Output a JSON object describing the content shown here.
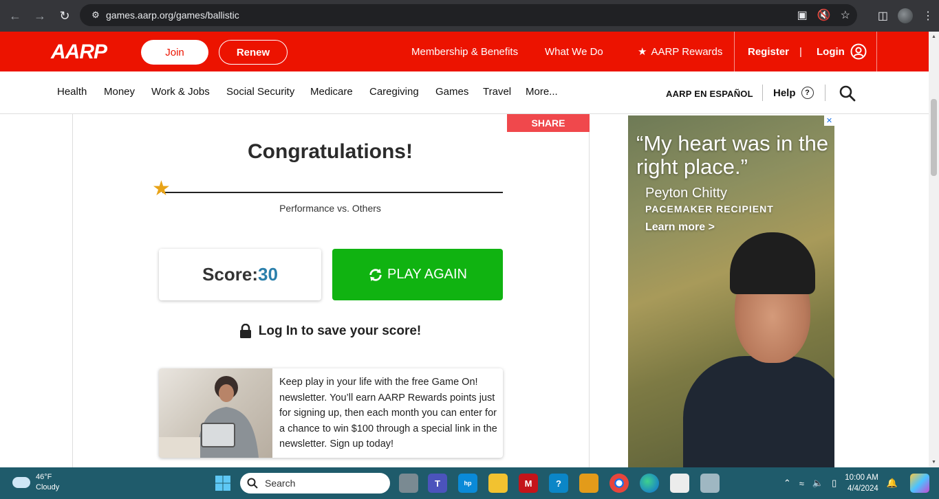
{
  "browser": {
    "url": "games.aarp.org/games/ballistic"
  },
  "header": {
    "logo": "AARP",
    "join": "Join",
    "renew": "Renew",
    "membership": "Membership & Benefits",
    "what_we_do": "What We Do",
    "rewards": "AARP Rewards",
    "register": "Register",
    "separator": "|",
    "login": "Login"
  },
  "subnav": {
    "items": [
      "Health",
      "Money",
      "Work & Jobs",
      "Social Security",
      "Medicare",
      "Caregiving",
      "Games",
      "Travel",
      "More..."
    ],
    "espanol": "AARP EN ESPAÑOL",
    "help": "Help",
    "help_glyph": "?"
  },
  "game": {
    "share": "SHARE",
    "title": "Congratulations!",
    "performance_label": "Performance vs. Others",
    "score_label": "Score:",
    "score_value": "30",
    "play_again": "PLAY AGAIN",
    "login_save": "Log In to save your score!",
    "promo_text": "Keep play in your life with the free Game On! newsletter. You’ll earn AARP Rewards points just for signing up, then each month you can enter for a chance to win $100 through a special link in the newsletter. Sign up today!"
  },
  "ad": {
    "quote": "“My heart was in the right place.”",
    "name": "Peyton Chitty",
    "role": "PACEMAKER RECIPIENT",
    "cta": "Learn more >",
    "close": "✕"
  },
  "taskbar": {
    "temp": "46°F",
    "condition": "Cloudy",
    "search_placeholder": "Search",
    "time": "10:00 AM",
    "date": "4/4/2024"
  },
  "colors": {
    "aarp_red": "#ec1300",
    "play_green": "#10b311",
    "score_blue": "#2a7fab",
    "share_red": "#f0484c",
    "star_gold": "#e8a317"
  }
}
